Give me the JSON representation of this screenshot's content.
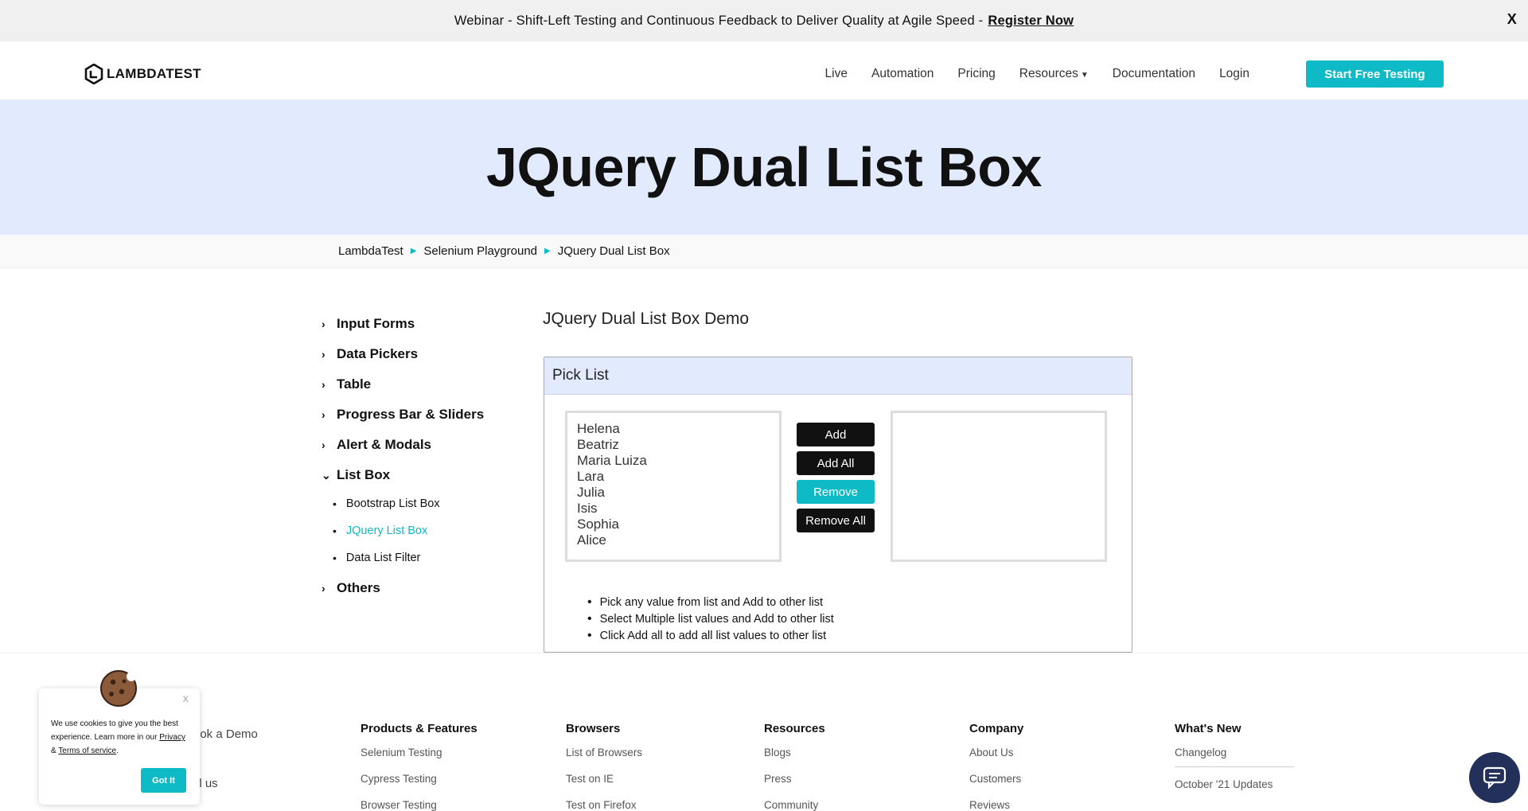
{
  "banner": {
    "text": "Webinar - Shift-Left Testing and Continuous Feedback to Deliver Quality at Agile Speed -",
    "link": "Register Now",
    "close": "X"
  },
  "header": {
    "logo_text": "LAMBDATEST",
    "nav": [
      "Live",
      "Automation",
      "Pricing",
      "Resources",
      "Documentation",
      "Login"
    ],
    "cta": "Start Free Testing"
  },
  "hero": {
    "title": "JQuery Dual List Box"
  },
  "breadcrumb": [
    "LambdaTest",
    "Selenium Playground",
    "JQuery Dual List Box"
  ],
  "sidebar": {
    "items": [
      "Input Forms",
      "Data Pickers",
      "Table",
      "Progress Bar & Sliders",
      "Alert & Modals",
      "List Box",
      "Others"
    ],
    "listbox_sub": [
      "Bootstrap List Box",
      "JQuery List Box",
      "Data List Filter"
    ],
    "active_sub": "JQuery List Box"
  },
  "main": {
    "title": "JQuery Dual List Box Demo",
    "panel_title": "Pick List",
    "left_options": [
      "Helena",
      "Beatriz",
      "Maria Luiza",
      "Lara",
      "Julia",
      "Isis",
      "Sophia",
      "Alice"
    ],
    "right_options": [],
    "buttons": {
      "add": "Add",
      "add_all": "Add All",
      "remove": "Remove",
      "remove_all": "Remove All"
    },
    "notes": [
      "Pick any value from list and Add to other list",
      "Select Multiple list values and Add to other list",
      "Click Add all to add all list values to other list"
    ]
  },
  "footer": {
    "partial_left": [
      "ook a Demo",
      "ll us"
    ],
    "columns": [
      {
        "title": "Products & Features",
        "links": [
          "Selenium Testing",
          "Cypress Testing",
          "Browser Testing"
        ]
      },
      {
        "title": "Browsers",
        "links": [
          "List of Browsers",
          "Test on IE",
          "Test on Firefox"
        ]
      },
      {
        "title": "Resources",
        "links": [
          "Blogs",
          "Press",
          "Community"
        ]
      },
      {
        "title": "Company",
        "links": [
          "About Us",
          "Customers",
          "Reviews"
        ]
      },
      {
        "title": "What's New",
        "links": [
          "Changelog",
          "October '21 Updates"
        ]
      }
    ]
  },
  "cookie": {
    "text_1": "We use cookies to give you the best experience. Learn more in our",
    "privacy": "Privacy",
    "amp": "&",
    "terms": "Terms of service",
    "period": ".",
    "button": "Got It",
    "close": "X"
  },
  "colors": {
    "accent": "#0ebac5",
    "hero_bg": "#e2ebfd",
    "dark": "#111111",
    "chat_bg": "#23305a"
  }
}
